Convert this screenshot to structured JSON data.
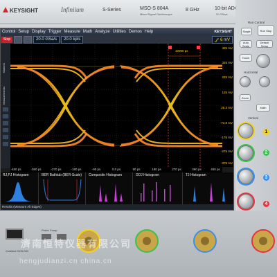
{
  "brand": {
    "company": "KEYSIGHT",
    "product_line": "Infiniium",
    "series": "S-Series",
    "model": "MSO-S 804A",
    "model_sub": "Mixed Signal Oscilloscope",
    "bandwidth": "8 GHz",
    "adc": "10-bit ADC",
    "sample": "20 GSa/s"
  },
  "menu": {
    "items": [
      "Control",
      "Setup",
      "Display",
      "Trigger",
      "Measure",
      "Math",
      "Analyze",
      "Utilities",
      "Demos",
      "Help"
    ],
    "logo": "KEYSIGHT"
  },
  "toolbar": {
    "stop_label": "Stop",
    "sample_rate": "20.0 GSa/s",
    "memory_depth": "20.0 kpts",
    "trigger_level": "6 mV"
  },
  "left_tabs": [
    "Markers",
    "Measurements"
  ],
  "eye": {
    "marker_label": "10000 ps",
    "y_labels": [
      "425 mV",
      "325 mV",
      "225 mV",
      "125 mV",
      "25.3 mV",
      "-74.8 mV",
      "-175 mV",
      "-275 mV",
      "-375 mV"
    ],
    "x_labels": [
      "-450 ps",
      "-360 ps",
      "-270 ps",
      "-180 ps",
      "-90 ps",
      "0.0 ps",
      "90 ps",
      "180 ps",
      "270 ps",
      "360 ps",
      "450 ps"
    ]
  },
  "histograms": [
    {
      "title": "RJ,PJ Histogram"
    },
    {
      "title": "BER Bathtub (BER-Scale)"
    },
    {
      "title": "Composite Histogram"
    },
    {
      "title": "DDJ Histogram"
    },
    {
      "title": "TJ Histogram"
    }
  ],
  "status": {
    "text": "Results  (Measure All Edges)"
  },
  "front_panel": {
    "run_control": "Run Control",
    "run_stop": "Run Stop",
    "single": "Single",
    "auto_scale": "Auto Scale",
    "default_setup": "Default Setup",
    "touch": "Touch",
    "horizontal": "Horizontal",
    "vertical": "Vertical",
    "zoom": "Zoom",
    "math": "Math",
    "ch_labels": [
      "1",
      "2",
      "3",
      "4"
    ],
    "ch_colors": [
      "#f5d21a",
      "#39c24a",
      "#3a8fe8",
      "#e8323c"
    ]
  },
  "bottom": {
    "probe_comp": "Probe Comp",
    "certified": "Certified ISO9,000",
    "watermark_cn": "濟南恒特仪器有限公司",
    "watermark_url": "hengjudianzi.cn china.cn"
  }
}
